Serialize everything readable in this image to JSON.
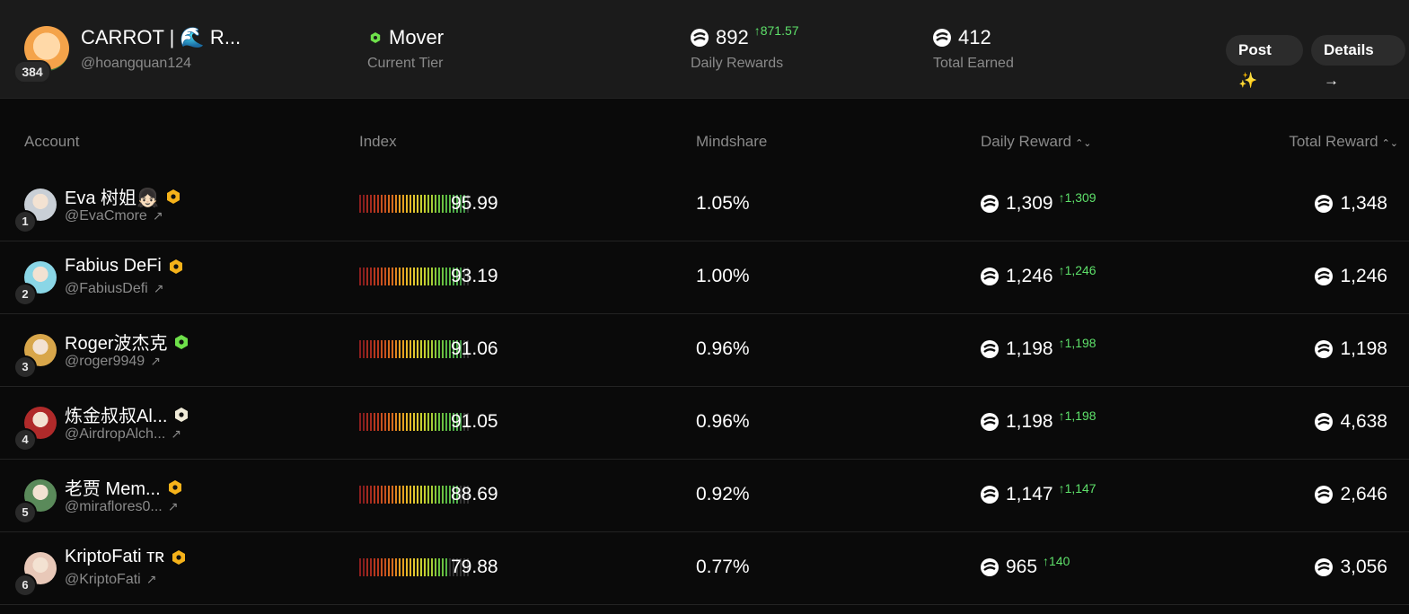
{
  "me": {
    "name": "CARROT | 🌊 R...",
    "handle": "@hoangquan124",
    "rank": "384",
    "tier": "Mover",
    "tier_label": "Current Tier",
    "daily_rewards": "892",
    "daily_delta": "↑871.57",
    "daily_label": "Daily Rewards",
    "total_earned": "412",
    "total_label": "Total Earned"
  },
  "actions": {
    "post": "Post ✨",
    "details": "Details →"
  },
  "columns": {
    "account": "Account",
    "index": "Index",
    "mindshare": "Mindshare",
    "daily_reward": "Daily Reward",
    "total_reward": "Total Reward",
    "sort_glyph": "⌃⌄"
  },
  "colors": {
    "accent_green": "#5ee06a",
    "tier_green": "#6ee04a",
    "badge_gold": "#f5b21a",
    "badge_white": "#f0ebd8"
  },
  "rows": [
    {
      "rank": "1",
      "name": "Eva 树姐👧🏻",
      "handle": "@EvaCmore",
      "badge": "gold",
      "index": "95.99",
      "index_score": 0.96,
      "mindshare": "1.05%",
      "daily": "1,309",
      "daily_delta": "↑1,309",
      "total": "1,348",
      "avatar_color": "#c9cfd6"
    },
    {
      "rank": "2",
      "name": "Fabius DeFi",
      "handle": "@FabiusDefi",
      "badge": "gold",
      "index": "93.19",
      "index_score": 0.93,
      "mindshare": "1.00%",
      "daily": "1,246",
      "daily_delta": "↑1,246",
      "total": "1,246",
      "avatar_color": "#8ad6e6"
    },
    {
      "rank": "3",
      "name": "Roger波杰克",
      "handle": "@roger9949",
      "badge": "green",
      "index": "91.06",
      "index_score": 0.91,
      "mindshare": "0.96%",
      "daily": "1,198",
      "daily_delta": "↑1,198",
      "total": "1,198",
      "avatar_color": "#d8a64a"
    },
    {
      "rank": "4",
      "name": "炼金叔叔Al...",
      "handle": "@AirdropAlch...",
      "badge": "white",
      "index": "91.05",
      "index_score": 0.91,
      "mindshare": "0.96%",
      "daily": "1,198",
      "daily_delta": "↑1,198",
      "total": "4,638",
      "avatar_color": "#b02a2a"
    },
    {
      "rank": "5",
      "name": "老贾 Mem...",
      "handle": "@miraflores0...",
      "badge": "gold",
      "index": "88.69",
      "index_score": 0.89,
      "mindshare": "0.92%",
      "daily": "1,147",
      "daily_delta": "↑1,147",
      "total": "2,646",
      "avatar_color": "#5a8a5a"
    },
    {
      "rank": "6",
      "name": "KriptoFati ᴛʀ",
      "handle": "@KriptoFati",
      "badge": "gold",
      "index": "79.88",
      "index_score": 0.8,
      "mindshare": "0.77%",
      "daily": "965",
      "daily_delta": "↑140",
      "total": "3,056",
      "avatar_color": "#e8c8b8"
    }
  ]
}
